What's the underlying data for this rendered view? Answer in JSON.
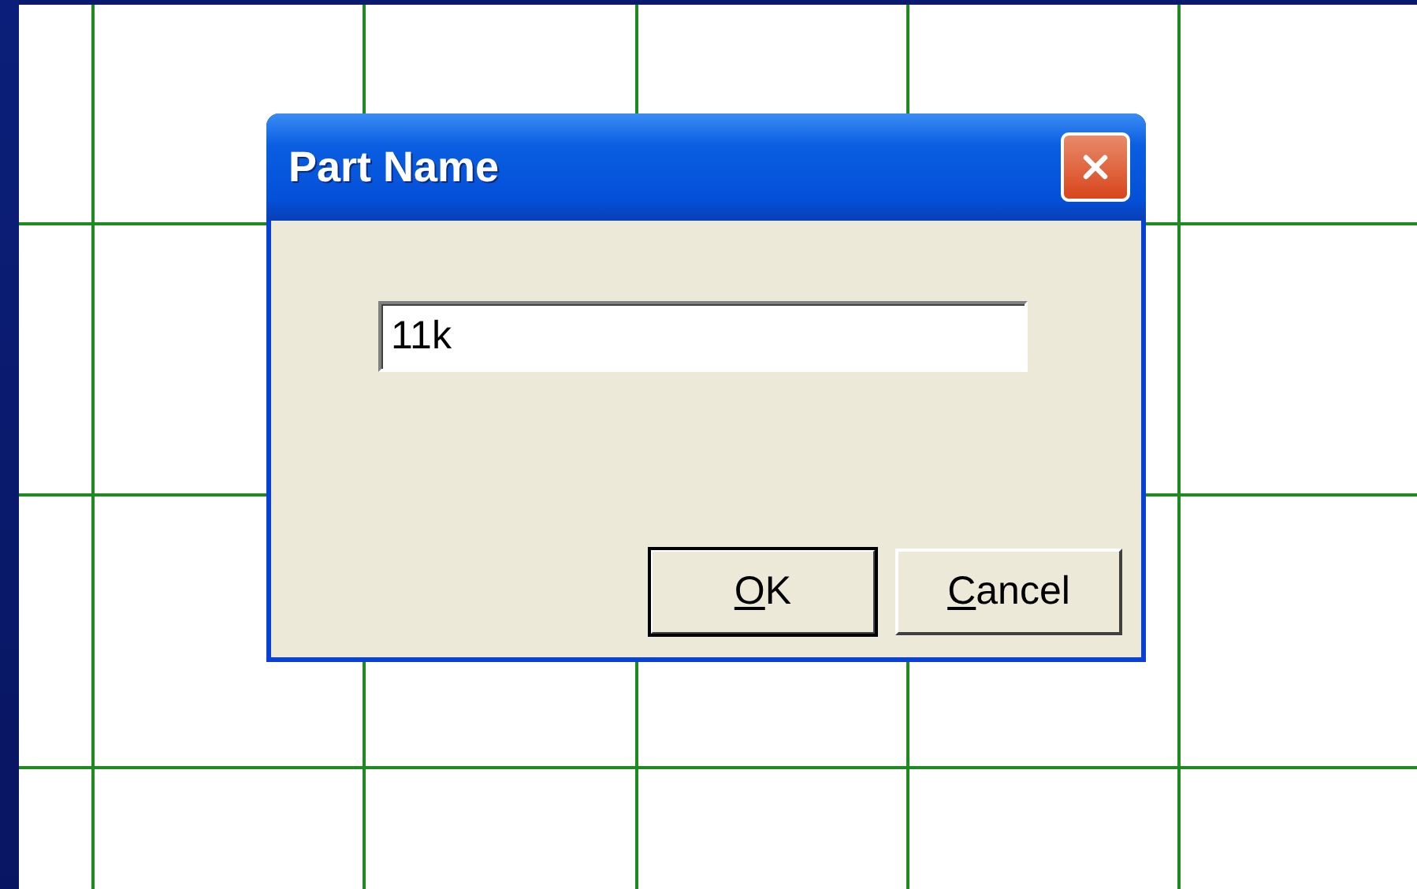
{
  "dialog": {
    "title": "Part Name",
    "field": {
      "value": "11k"
    },
    "buttons": [
      {
        "label": "OK",
        "default": true,
        "mnemonic": true
      },
      {
        "label": "Cancel",
        "default": false,
        "mnemonic": true
      }
    ]
  }
}
